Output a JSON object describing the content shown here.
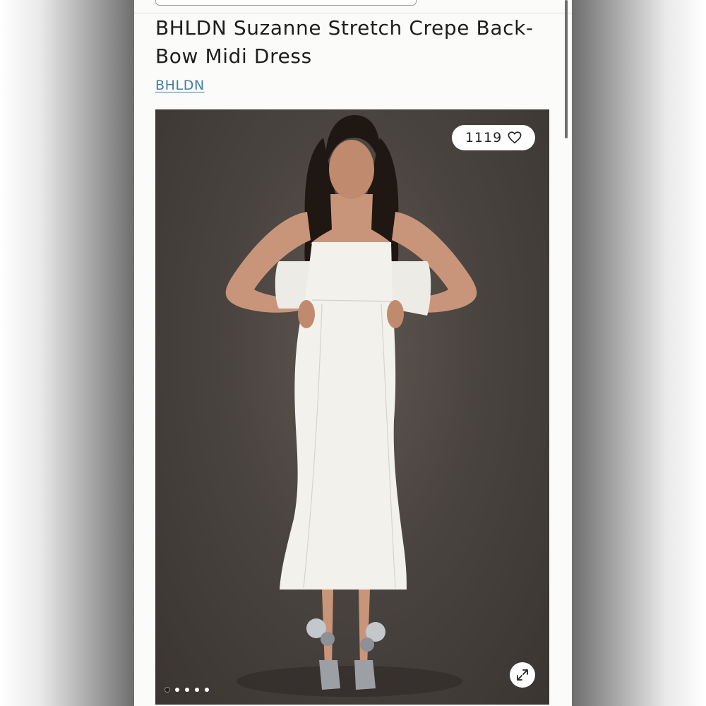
{
  "product": {
    "title": "BHLDN Suzanne Stretch Crepe Back-Bow Midi Dress",
    "brand": "BHLDN"
  },
  "gallery": {
    "likes_count": "1119",
    "like_icon": "heart-icon",
    "expand_icon": "expand-icon",
    "dots_total": 5,
    "active_dot": 1
  },
  "colors": {
    "brand_link": "#3f7fa3",
    "photo_background": "#4a4440",
    "dress": "#f3f1ec"
  }
}
